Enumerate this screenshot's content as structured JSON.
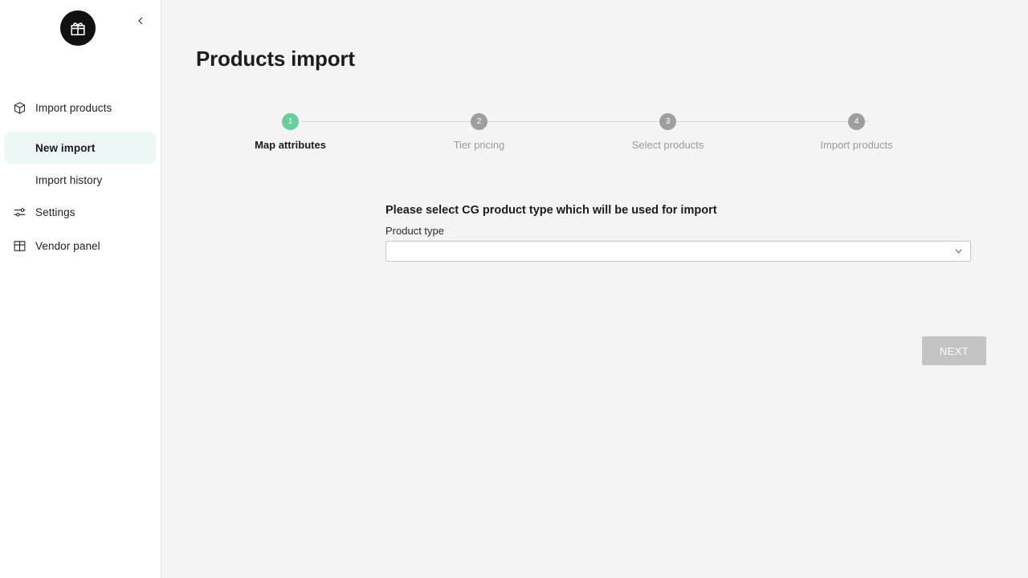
{
  "sidebar": {
    "logo_icon": "gift-box-icon",
    "collapse_icon": "chevron-left-icon",
    "items": [
      {
        "id": "import-products",
        "label": "Import products",
        "icon": "package-box-icon",
        "active": false,
        "sub": false
      },
      {
        "id": "new-import",
        "label": "New import",
        "icon": "",
        "active": true,
        "sub": true
      },
      {
        "id": "import-history",
        "label": "Import history",
        "icon": "",
        "active": false,
        "sub": true
      },
      {
        "id": "settings",
        "label": "Settings",
        "icon": "sliders-icon",
        "active": false,
        "sub": false
      },
      {
        "id": "vendor-panel",
        "label": "Vendor panel",
        "icon": "layout-panel-icon",
        "active": false,
        "sub": false
      }
    ]
  },
  "header": {
    "title": "Products import"
  },
  "stepper": {
    "active_color": "#68ce9b",
    "inactive_color": "#9e9e9e",
    "steps": [
      {
        "number": "1",
        "label": "Map attributes",
        "state": "active"
      },
      {
        "number": "2",
        "label": "Tier pricing",
        "state": "inactive"
      },
      {
        "number": "3",
        "label": "Select products",
        "state": "inactive"
      },
      {
        "number": "4",
        "label": "Import products",
        "state": "inactive"
      }
    ]
  },
  "form": {
    "heading": "Please select CG product type which will be used for import",
    "product_type": {
      "label": "Product type",
      "value": "",
      "placeholder": "",
      "caret_icon": "chevron-down-icon",
      "options": [
        ""
      ]
    }
  },
  "actions": {
    "next_label": "NEXT",
    "next_disabled_color": "#c4c4c4"
  }
}
